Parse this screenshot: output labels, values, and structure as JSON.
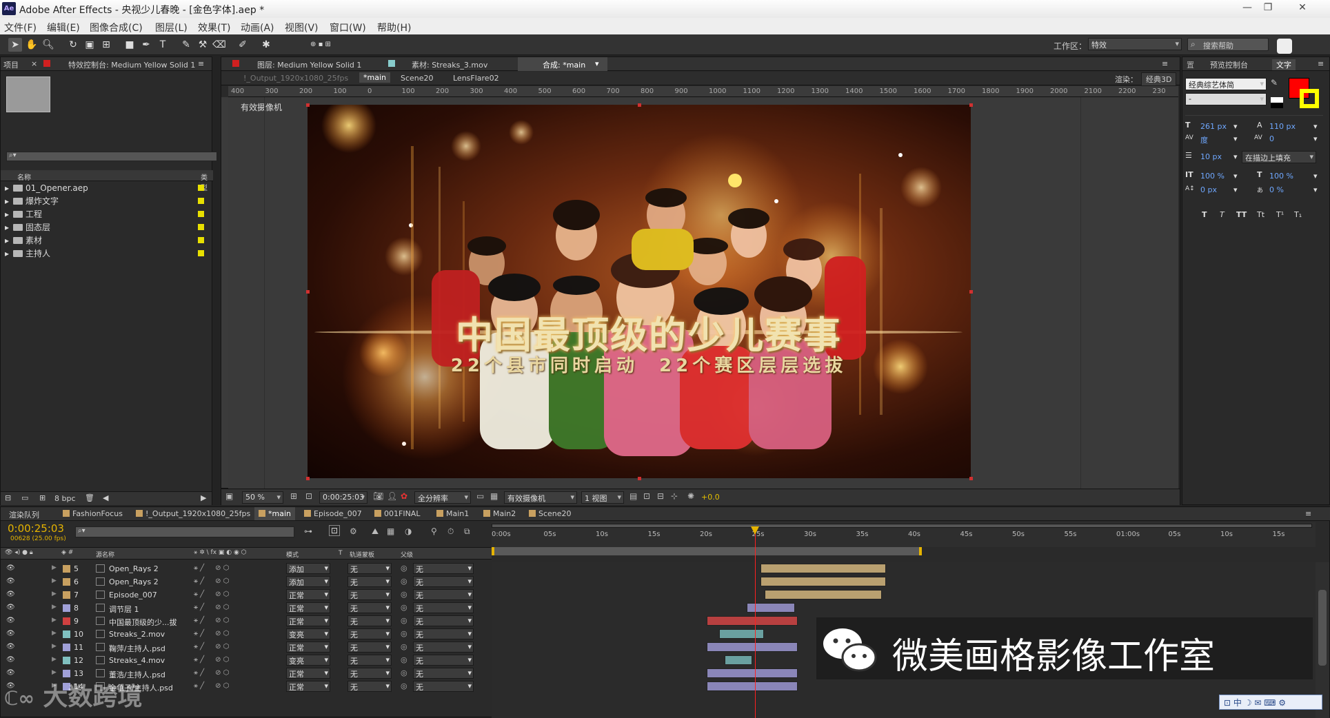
{
  "window": {
    "title": "Adobe After Effects - 央视少儿春晚 - [金色字体].aep *",
    "app_icon": "Ae",
    "controls": [
      "—",
      "❐",
      "✕"
    ]
  },
  "menu": [
    "文件(F)",
    "编辑(E)",
    "图像合成(C)",
    "图层(L)",
    "效果(T)",
    "动画(A)",
    "视图(V)",
    "窗口(W)",
    "帮助(H)"
  ],
  "toolbar": {
    "workspace_label": "工作区：",
    "workspace_value": "特效",
    "search_help": "搜索帮助"
  },
  "project_panel": {
    "tab_project": "项目",
    "tab_effect_controls": "特效控制台: Medium Yellow Solid 1",
    "col_name": "名称",
    "col_type": "类型",
    "items": [
      "01_Opener.aep",
      "爆炸文字",
      "工程",
      "固态层",
      "素材",
      "主持人"
    ],
    "bpc": "8 bpc"
  },
  "viewer": {
    "tab_layer": "图层: Medium Yellow Solid 1",
    "tab_footage": "素材: Streaks_3.mov",
    "tab_comp": "合成: *main",
    "breadcrumbs": [
      "!_Output_1920x1080_25fps",
      "*main",
      "Scene20",
      "LensFlare02"
    ],
    "render_label": "渲染：",
    "render_value": "经典3D",
    "camera_label": "有效摄像机",
    "ruler_ticks": [
      "400",
      "300",
      "200",
      "100",
      "0",
      "100",
      "200",
      "300",
      "400",
      "500",
      "600",
      "700",
      "800",
      "900",
      "1000",
      "1100",
      "1200",
      "1300",
      "1400",
      "1500",
      "1600",
      "1700",
      "1800",
      "1900",
      "2000",
      "2100",
      "2200",
      "230"
    ],
    "headline": "中国最顶级的少儿赛事",
    "subline": "22个县市同时启动  22个赛区层层选拔",
    "zoom": "50 %",
    "timecode": "0:00:25:03",
    "resolution": "全分辨率",
    "view_camera": "有效摄像机",
    "views": "1 视图",
    "exposure": "+0.0"
  },
  "character_panel": {
    "tab1": "预览控制台",
    "tab2": "文字",
    "font": "经典综艺体简",
    "style": "-",
    "size": "261 px",
    "leading": "110 px",
    "kerning": "度",
    "tracking": "0",
    "stroke": "10 px",
    "stroke_mode": "在描边上填充",
    "vscale": "100 %",
    "hscale": "100 %",
    "baseline": "0 px",
    "tsume": "0 %",
    "styles": [
      "T",
      "T",
      "TT",
      "Tt",
      "T¹",
      "T₁"
    ],
    "fill_color": "#ff0000",
    "stroke_color": "#ffff00"
  },
  "timeline": {
    "tabs": [
      "渲染队列",
      "FashionFocus",
      "!_Output_1920x1080_25fps",
      "*main",
      "Episode_007",
      "001FINAL",
      "Main1",
      "Main2",
      "Scene20"
    ],
    "timecode": "0:00:25:03",
    "frame_info": "00628 (25.00 fps)",
    "col_source": "源名称",
    "col_mode": "模式",
    "col_t": "T",
    "col_trkmat": "轨道蒙板",
    "col_parent": "父级",
    "ruler": [
      "0:00s",
      "05s",
      "10s",
      "15s",
      "20s",
      "25s",
      "30s",
      "35s",
      "40s",
      "45s",
      "50s",
      "55s",
      "01:00s",
      "05s",
      "10s",
      "15s"
    ],
    "layers": [
      {
        "num": "5",
        "name": "Open_Rays 2",
        "mode": "添加",
        "trk": "无",
        "parent": "无",
        "color": "#c8a060"
      },
      {
        "num": "6",
        "name": "Open_Rays 2",
        "mode": "添加",
        "trk": "无",
        "parent": "无",
        "color": "#c8a060"
      },
      {
        "num": "7",
        "name": "Episode_007",
        "mode": "正常",
        "trk": "无",
        "parent": "无",
        "color": "#c8a060"
      },
      {
        "num": "8",
        "name": "调节层 1",
        "mode": "正常",
        "trk": "无",
        "parent": "无",
        "color": "#a0a0d8"
      },
      {
        "num": "9",
        "name": "中国最顶级的少...拔",
        "mode": "正常",
        "trk": "无",
        "parent": "无",
        "color": "#d04040"
      },
      {
        "num": "10",
        "name": "Streaks_2.mov",
        "mode": "变亮",
        "trk": "无",
        "parent": "无",
        "color": "#80c0c0"
      },
      {
        "num": "11",
        "name": "鞠萍/主持人.psd",
        "mode": "正常",
        "trk": "无",
        "parent": "无",
        "color": "#a0a0d8"
      },
      {
        "num": "12",
        "name": "Streaks_4.mov",
        "mode": "变亮",
        "trk": "无",
        "parent": "无",
        "color": "#80c0c0"
      },
      {
        "num": "13",
        "name": "董浩/主持人.psd",
        "mode": "正常",
        "trk": "无",
        "parent": "无",
        "color": "#a0a0d8"
      },
      {
        "num": "14",
        "name": "金龟子/主持人.psd",
        "mode": "正常",
        "trk": "无",
        "parent": "无",
        "color": "#a0a0d8"
      }
    ]
  },
  "watermark": {
    "wechat": "微美画格影像工作室",
    "corner": "大数跨境"
  },
  "ime": "中"
}
